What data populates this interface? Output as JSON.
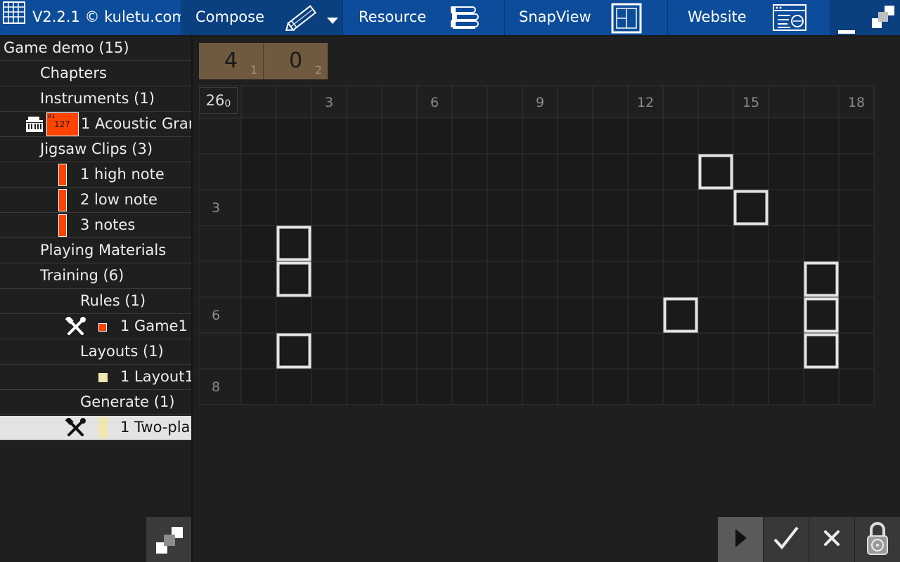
{
  "topbar": {
    "version_label": "V2.2.1 © kuletu.com",
    "compose_label": "Compose",
    "resource_label": "Resource",
    "snapview_label": "SnapView",
    "website_label": "Website"
  },
  "sidebar": {
    "game_title": "Game demo (15)",
    "chapters": "Chapters",
    "instruments": "Instruments (1)",
    "instrument_item": "1 Acoustic Gran",
    "instrument_badge_value": "127",
    "instrument_badge_tag": "A1",
    "jigsaw_clips": "Jigsaw Clips (3)",
    "clips": [
      "1 high note",
      "2 low note",
      "3 notes"
    ],
    "playing_materials": "Playing Materials",
    "training": "Training (6)",
    "rules": "Rules (1)",
    "rule_item": "1 Game1",
    "layouts": "Layouts (1)",
    "layout_item": "1 Layout1",
    "generate": "Generate (1)",
    "generate_item": "1 Two-pla"
  },
  "scoreboard": {
    "cells": [
      {
        "value": "4",
        "sub": "1"
      },
      {
        "value": "0",
        "sub": "2"
      }
    ]
  },
  "grid": {
    "corner_value": "26",
    "corner_sub": "0",
    "col_labels": [
      "3",
      "6",
      "9",
      "12",
      "15",
      "18"
    ],
    "row_labels": [
      "3",
      "6",
      "8"
    ],
    "cols": 18,
    "rows": 8,
    "marked_cells": [
      {
        "col": 14,
        "row": 1
      },
      {
        "col": 15,
        "row": 2
      },
      {
        "col": 2,
        "row": 3
      },
      {
        "col": 2,
        "row": 4
      },
      {
        "col": 17,
        "row": 4
      },
      {
        "col": 13,
        "row": 5
      },
      {
        "col": 17,
        "row": 5
      },
      {
        "col": 2,
        "row": 6
      },
      {
        "col": 17,
        "row": 6
      }
    ]
  },
  "colors": {
    "topbar": "#0c4c9a",
    "clip": "#ff4400",
    "score_box": "#6f5a40",
    "layout_swatch": "#f0e6b0",
    "selection": "#e3e3e3"
  },
  "controls": {
    "play": "play-icon",
    "confirm": "check-icon",
    "cancel": "close-icon",
    "lock": "lock-icon"
  }
}
